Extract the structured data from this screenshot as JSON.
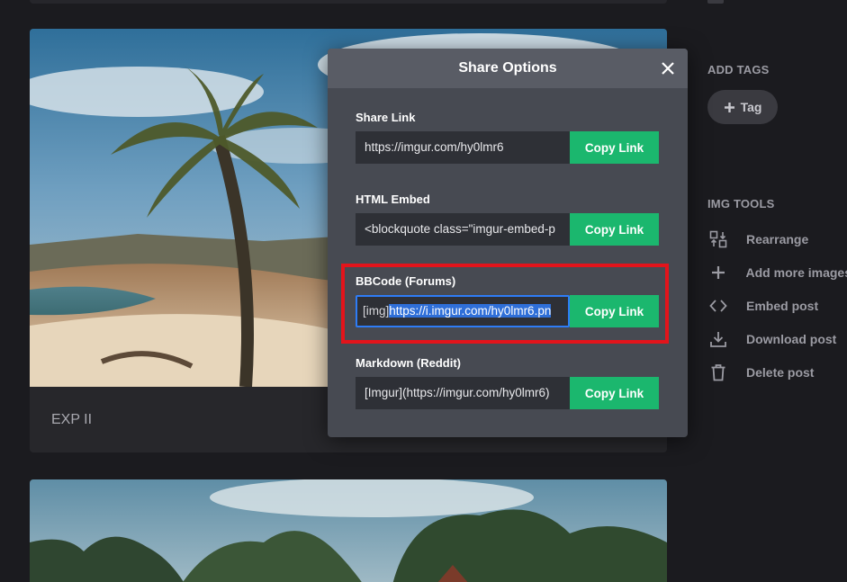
{
  "post": {
    "title": "EXP II"
  },
  "sidebar": {
    "add_tags_heading": "ADD TAGS",
    "tag_button_label": "Tag",
    "img_tools_heading": "IMG TOOLS",
    "tools": [
      {
        "label": "Rearrange",
        "icon": "rearrange-icon"
      },
      {
        "label": "Add more images",
        "icon": "plus-icon"
      },
      {
        "label": "Embed post",
        "icon": "code-icon"
      },
      {
        "label": "Download post",
        "icon": "download-icon"
      },
      {
        "label": "Delete post",
        "icon": "trash-icon"
      }
    ]
  },
  "modal": {
    "title": "Share Options",
    "fields": [
      {
        "label": "Share Link",
        "value": "https://imgur.com/hy0lmr6",
        "button": "Copy Link"
      },
      {
        "label": "HTML Embed",
        "value": "<blockquote class=\"imgur-embed-p",
        "button": "Copy Link"
      },
      {
        "label": "BBCode (Forums)",
        "value_prefix": "[img]",
        "value_selected": "https://i.imgur.com/hy0lmr6.pn",
        "button": "Copy Link"
      },
      {
        "label": "Markdown (Reddit)",
        "value": "[Imgur](https://imgur.com/hy0lmr6)",
        "button": "Copy Link"
      }
    ]
  },
  "colors": {
    "accent_green": "#1bb76e",
    "highlight_red": "#e3141b",
    "selection_blue": "#2f6fd8"
  }
}
